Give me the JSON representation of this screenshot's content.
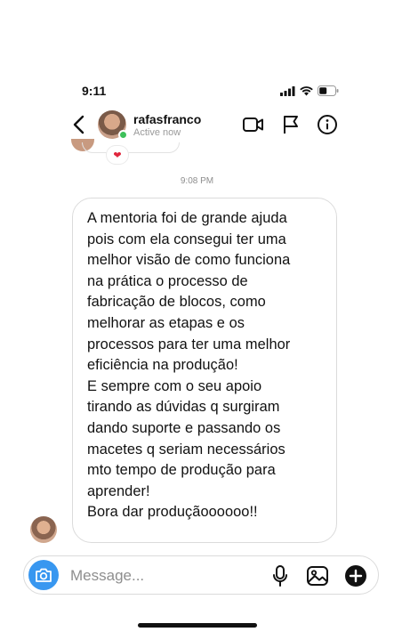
{
  "status_bar": {
    "time": "9:11",
    "icons": [
      "signal-icon",
      "wifi-icon",
      "battery-icon"
    ]
  },
  "header": {
    "username": "rafasfranco",
    "status": "Active now",
    "icons": [
      "back-chevron-icon",
      "video-call-icon",
      "flag-icon",
      "info-icon"
    ],
    "online_color": "#3ec05a"
  },
  "thread": {
    "previous_reaction": "❤",
    "timestamp": "9:08 PM",
    "message": {
      "text": "A mentoria foi de grande ajuda\npois com ela consegui ter uma\nmelhor visão de como funciona\nna prática o processo de\nfabricação de blocos, como\nmelhorar as etapas e os\nprocessos para ter uma melhor\neficiência na produção!\nE sempre com o seu apoio\ntirando as dúvidas q surgiram\ndando suporte e passando os\nmacetes q seriam necessários\nmto tempo de produção para\naprender!\nBora dar produçãoooooo!!"
    }
  },
  "composer": {
    "placeholder": "Message...",
    "value": "",
    "icons": [
      "camera-icon",
      "microphone-icon",
      "gallery-icon",
      "add-icon"
    ],
    "accent_color": "#3897f0"
  }
}
